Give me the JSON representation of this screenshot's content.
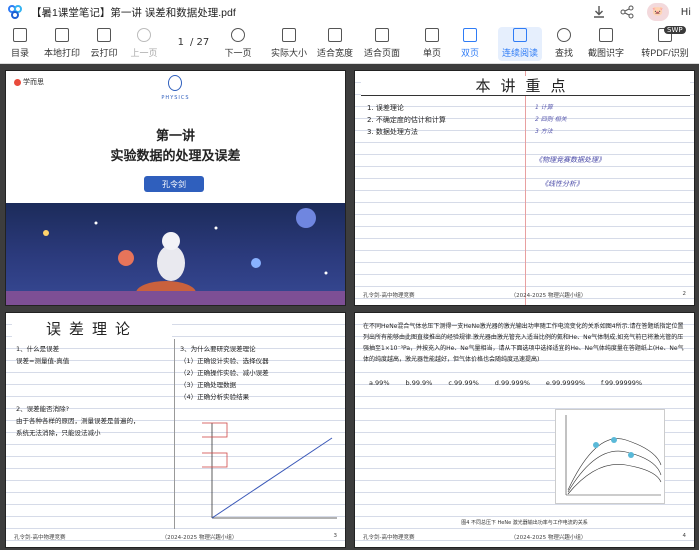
{
  "titlebar": {
    "doc_title": "【暑1课堂笔记】第一讲 误差和数据处理.pdf",
    "greeting": "Hi"
  },
  "toolbar": {
    "items": [
      {
        "label": "目录",
        "icon": "menu-icon"
      },
      {
        "label": "本地打印",
        "icon": "print-icon"
      },
      {
        "label": "云打印",
        "icon": "cloud-print-icon"
      },
      {
        "label": "上一页",
        "icon": "prev-page-icon"
      },
      {
        "label": "下一页",
        "icon": "next-page-icon"
      },
      {
        "label": "实际大小",
        "icon": "actual-size-icon"
      },
      {
        "label": "适合宽度",
        "icon": "fit-width-icon"
      },
      {
        "label": "适合页面",
        "icon": "fit-page-icon"
      },
      {
        "label": "单页",
        "icon": "single-page-icon"
      },
      {
        "label": "双页",
        "icon": "double-page-icon"
      },
      {
        "label": "连续阅读",
        "icon": "continuous-icon"
      },
      {
        "label": "查找",
        "icon": "search-icon"
      },
      {
        "label": "截图识字",
        "icon": "ocr-icon"
      },
      {
        "label": "转PDF/识别",
        "icon": "convert-icon"
      }
    ],
    "current_page": "1",
    "total_pages": "/ 27",
    "badge": "SWP"
  },
  "pages": {
    "p1": {
      "brand": "学而思",
      "subject": "PHYSICS",
      "line1": "第一讲",
      "line2": "实验数据的处理及误差",
      "author": "孔令剑"
    },
    "p2": {
      "header": "本讲重点",
      "items": [
        "1. 误差理论",
        "2. 不确定度的估计和计算",
        "3. 数据处理方法"
      ],
      "notes": [
        "1 计算",
        "2 四则 相关",
        "3 方法"
      ],
      "scribble1": "《物理竞赛数据处理》",
      "scribble2": "《线性分析》",
      "footer_left": "孔令剑-高中物理竞赛",
      "footer_mid": "（2024-2025 物理兴趣小组）",
      "footer_right": "2"
    },
    "p3": {
      "header": "误差理论",
      "left": [
        "1、什么是误差",
        "误差=测量值-真值",
        "",
        "",
        "",
        "2、误差能否消除?",
        "由于各种各样的原因，测量误差是普遍的，",
        "系统无法消除，只能设法减小"
      ],
      "right": [
        "3、为什么要研究误差理论",
        "（1）正确设计实验、选择仪器",
        "（2）正确操作实验、减小误差",
        "（3）正确处理数据",
        "（4）正确分析实验结果"
      ],
      "footer_left": "孔令剑-高中物理竞赛",
      "footer_mid": "（2024-2025 物理兴趣小组）",
      "footer_right": "3"
    },
    "p4": {
      "text": "在不同HeNe混合气体总压下测得一支HeNe激光器的激光输出功率随工作电流变化的关系如图4所示.请在答题纸指定位置列出所有能够由此图直接推出的经验规律.激光器由激光管充入适当比例的氦和He、Ne气体制成,如充气前已将激光管的压强抽至1×10⁻³Pa，并按充入的He、Ne气量相当，请从下面选项中选择适宜的He、Ne气体纯度量在答题纸上(He、Ne气体的纯度越高，激光器性能越好，但气体价格也会随纯度迅速提高)",
      "options": [
        "a.99%",
        "b.99.9%",
        "c.99.99%",
        "d.99.999%",
        "e.99.9999%",
        "f.99.99999%"
      ],
      "caption": "图4 不同总压下 HeNe 激光器输出功率与工作电流的关系",
      "footer_left": "孔令剑-高中物理竞赛",
      "footer_mid": "（2024-2025 物理兴趣小组）",
      "footer_right": "4"
    }
  }
}
